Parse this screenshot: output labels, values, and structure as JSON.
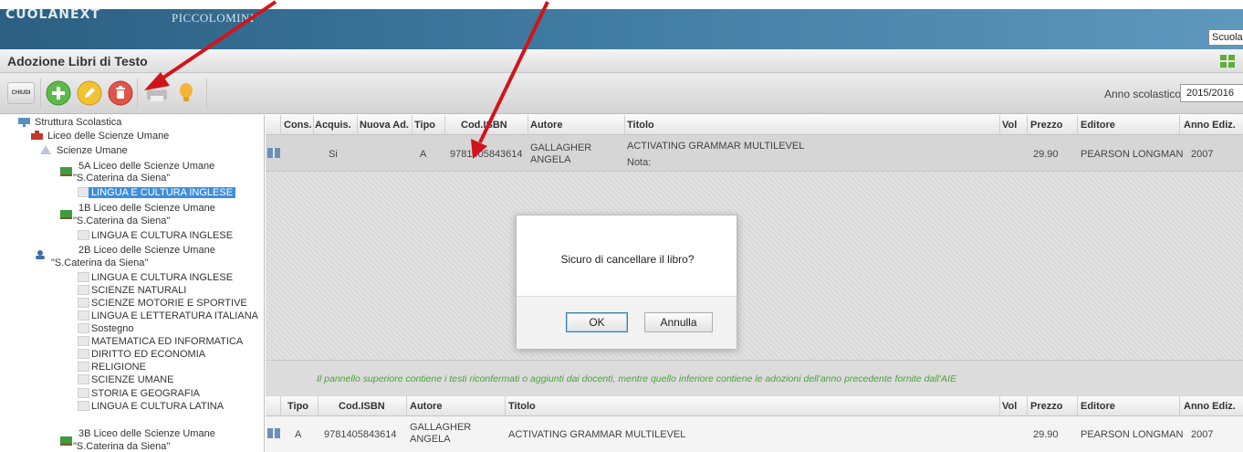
{
  "header": {
    "logo": "CUOLANEXT",
    "school": "PICCOLOMINI\"",
    "scope_select": "Scuola"
  },
  "title": "Adozione Libri di Testo",
  "toolbar": {
    "close_label": "CHIUDI",
    "year_label": "Anno scolastico:",
    "year_value": "2015/2016"
  },
  "tree": {
    "root": "Struttura Scolastica",
    "school": "Liceo delle Scienze Umane",
    "course": "Scienze Umane",
    "class_5a_line1": "5A Liceo delle Scienze Umane",
    "class_5a_line2": "\"S.Caterina da Siena\"",
    "class_5a_subject": "LINGUA E CULTURA INGLESE",
    "class_1b_line1": "1B Liceo delle Scienze Umane",
    "class_1b_line2": "\"S.Caterina da Siena\"",
    "class_1b_subject": "LINGUA E CULTURA INGLESE",
    "class_2b_line1": "2B Liceo delle Scienze Umane",
    "class_2b_line2": "\"S.Caterina da Siena\"",
    "class_2b_subjects": [
      "LINGUA E CULTURA INGLESE",
      "SCIENZE NATURALI",
      "SCIENZE MOTORIE E SPORTIVE",
      "LINGUA E LETTERATURA ITALIANA",
      "Sostegno",
      "MATEMATICA ED INFORMATICA",
      "DIRITTO ED ECONOMIA",
      "RELIGIONE",
      "SCIENZE UMANE",
      "STORIA E GEOGRAFIA",
      "LINGUA E CULTURA LATINA"
    ],
    "class_3b_line1": "3B Liceo delle Scienze Umane",
    "class_3b_line2": "\"S.Caterina da Siena\""
  },
  "grid_top": {
    "headers": [
      "Cons.",
      "Acquis.",
      "Nuova Ad.",
      "Tipo",
      "Cod.ISBN",
      "Autore",
      "Titolo",
      "Vol",
      "Prezzo",
      "Editore",
      "Anno Ediz."
    ],
    "row": {
      "acquis": "Si",
      "tipo": "A",
      "isbn": "9781405843614",
      "autore_line1": "GALLAGHER",
      "autore_line2": "ANGELA",
      "titolo": "ACTIVATING GRAMMAR MULTILEVEL",
      "nota": "Nota:",
      "prezzo": "29.90",
      "editore": "PEARSON LONGMAN",
      "anno": "2007"
    }
  },
  "info": "Il pannello superiore contiene i testi riconfermati o aggiunti dai docenti, mentre quello inferiore contiene le adozioni dell'anno precedente fornite dall'AIE",
  "grid_bottom": {
    "headers": [
      "Tipo",
      "Cod.ISBN",
      "Autore",
      "Titolo",
      "Vol",
      "Prezzo",
      "Editore",
      "Anno Ediz."
    ],
    "row": {
      "tipo": "A",
      "isbn": "9781405843614",
      "autore_line1": "GALLAGHER",
      "autore_line2": "ANGELA",
      "titolo": "ACTIVATING GRAMMAR MULTILEVEL",
      "prezzo": "29.90",
      "editore": "PEARSON LONGMAN",
      "anno": "2007"
    }
  },
  "dialog": {
    "message": "Sicuro di cancellare il libro?",
    "ok": "OK",
    "cancel": "Annulla"
  },
  "colors": {
    "header_blue": "#3f7aa0",
    "annotation_red": "#d0151a",
    "info_green": "#4aa33a",
    "selection_blue": "#3d8edb"
  }
}
